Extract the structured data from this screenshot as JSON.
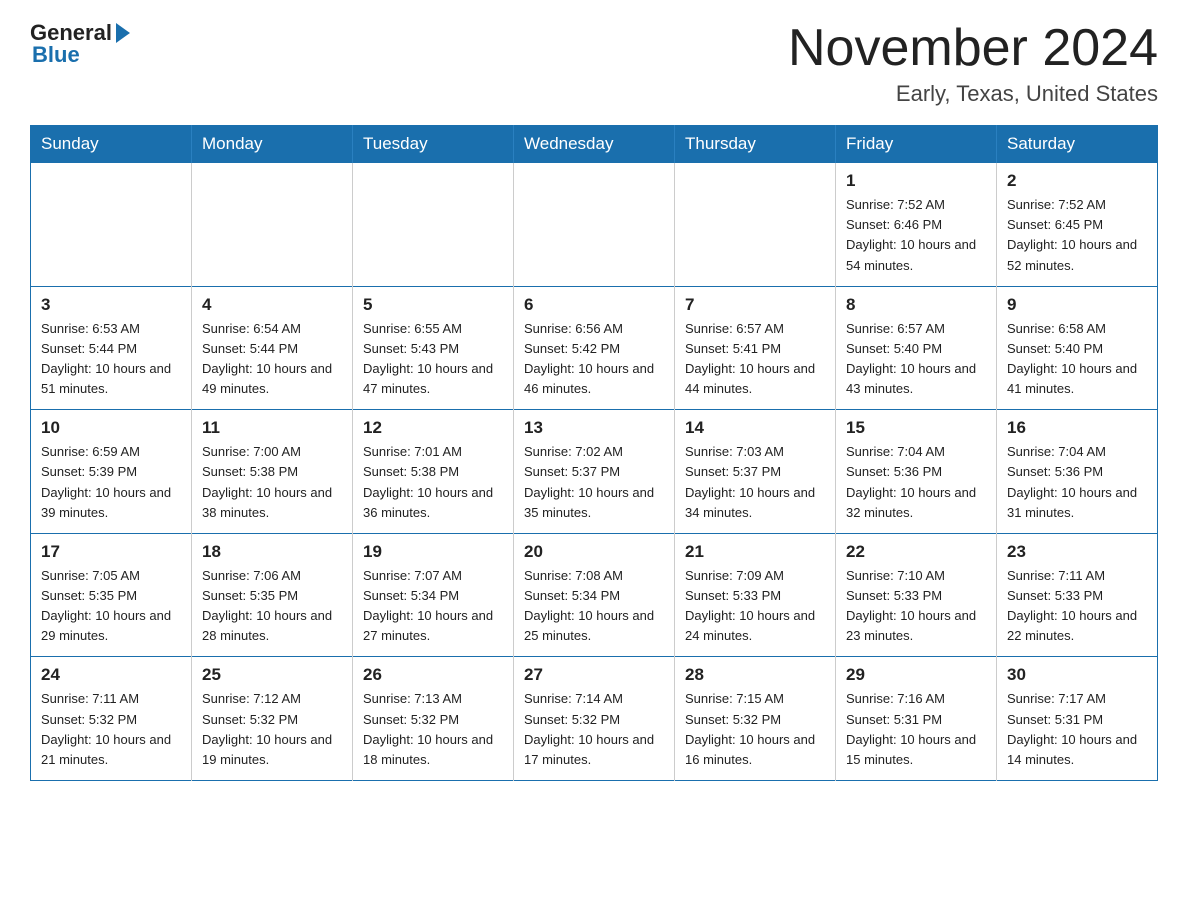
{
  "header": {
    "logo_general": "General",
    "logo_blue": "Blue",
    "month_title": "November 2024",
    "location": "Early, Texas, United States"
  },
  "weekdays": [
    "Sunday",
    "Monday",
    "Tuesday",
    "Wednesday",
    "Thursday",
    "Friday",
    "Saturday"
  ],
  "weeks": [
    [
      {
        "day": "",
        "sunrise": "",
        "sunset": "",
        "daylight": ""
      },
      {
        "day": "",
        "sunrise": "",
        "sunset": "",
        "daylight": ""
      },
      {
        "day": "",
        "sunrise": "",
        "sunset": "",
        "daylight": ""
      },
      {
        "day": "",
        "sunrise": "",
        "sunset": "",
        "daylight": ""
      },
      {
        "day": "",
        "sunrise": "",
        "sunset": "",
        "daylight": ""
      },
      {
        "day": "1",
        "sunrise": "Sunrise: 7:52 AM",
        "sunset": "Sunset: 6:46 PM",
        "daylight": "Daylight: 10 hours and 54 minutes."
      },
      {
        "day": "2",
        "sunrise": "Sunrise: 7:52 AM",
        "sunset": "Sunset: 6:45 PM",
        "daylight": "Daylight: 10 hours and 52 minutes."
      }
    ],
    [
      {
        "day": "3",
        "sunrise": "Sunrise: 6:53 AM",
        "sunset": "Sunset: 5:44 PM",
        "daylight": "Daylight: 10 hours and 51 minutes."
      },
      {
        "day": "4",
        "sunrise": "Sunrise: 6:54 AM",
        "sunset": "Sunset: 5:44 PM",
        "daylight": "Daylight: 10 hours and 49 minutes."
      },
      {
        "day": "5",
        "sunrise": "Sunrise: 6:55 AM",
        "sunset": "Sunset: 5:43 PM",
        "daylight": "Daylight: 10 hours and 47 minutes."
      },
      {
        "day": "6",
        "sunrise": "Sunrise: 6:56 AM",
        "sunset": "Sunset: 5:42 PM",
        "daylight": "Daylight: 10 hours and 46 minutes."
      },
      {
        "day": "7",
        "sunrise": "Sunrise: 6:57 AM",
        "sunset": "Sunset: 5:41 PM",
        "daylight": "Daylight: 10 hours and 44 minutes."
      },
      {
        "day": "8",
        "sunrise": "Sunrise: 6:57 AM",
        "sunset": "Sunset: 5:40 PM",
        "daylight": "Daylight: 10 hours and 43 minutes."
      },
      {
        "day": "9",
        "sunrise": "Sunrise: 6:58 AM",
        "sunset": "Sunset: 5:40 PM",
        "daylight": "Daylight: 10 hours and 41 minutes."
      }
    ],
    [
      {
        "day": "10",
        "sunrise": "Sunrise: 6:59 AM",
        "sunset": "Sunset: 5:39 PM",
        "daylight": "Daylight: 10 hours and 39 minutes."
      },
      {
        "day": "11",
        "sunrise": "Sunrise: 7:00 AM",
        "sunset": "Sunset: 5:38 PM",
        "daylight": "Daylight: 10 hours and 38 minutes."
      },
      {
        "day": "12",
        "sunrise": "Sunrise: 7:01 AM",
        "sunset": "Sunset: 5:38 PM",
        "daylight": "Daylight: 10 hours and 36 minutes."
      },
      {
        "day": "13",
        "sunrise": "Sunrise: 7:02 AM",
        "sunset": "Sunset: 5:37 PM",
        "daylight": "Daylight: 10 hours and 35 minutes."
      },
      {
        "day": "14",
        "sunrise": "Sunrise: 7:03 AM",
        "sunset": "Sunset: 5:37 PM",
        "daylight": "Daylight: 10 hours and 34 minutes."
      },
      {
        "day": "15",
        "sunrise": "Sunrise: 7:04 AM",
        "sunset": "Sunset: 5:36 PM",
        "daylight": "Daylight: 10 hours and 32 minutes."
      },
      {
        "day": "16",
        "sunrise": "Sunrise: 7:04 AM",
        "sunset": "Sunset: 5:36 PM",
        "daylight": "Daylight: 10 hours and 31 minutes."
      }
    ],
    [
      {
        "day": "17",
        "sunrise": "Sunrise: 7:05 AM",
        "sunset": "Sunset: 5:35 PM",
        "daylight": "Daylight: 10 hours and 29 minutes."
      },
      {
        "day": "18",
        "sunrise": "Sunrise: 7:06 AM",
        "sunset": "Sunset: 5:35 PM",
        "daylight": "Daylight: 10 hours and 28 minutes."
      },
      {
        "day": "19",
        "sunrise": "Sunrise: 7:07 AM",
        "sunset": "Sunset: 5:34 PM",
        "daylight": "Daylight: 10 hours and 27 minutes."
      },
      {
        "day": "20",
        "sunrise": "Sunrise: 7:08 AM",
        "sunset": "Sunset: 5:34 PM",
        "daylight": "Daylight: 10 hours and 25 minutes."
      },
      {
        "day": "21",
        "sunrise": "Sunrise: 7:09 AM",
        "sunset": "Sunset: 5:33 PM",
        "daylight": "Daylight: 10 hours and 24 minutes."
      },
      {
        "day": "22",
        "sunrise": "Sunrise: 7:10 AM",
        "sunset": "Sunset: 5:33 PM",
        "daylight": "Daylight: 10 hours and 23 minutes."
      },
      {
        "day": "23",
        "sunrise": "Sunrise: 7:11 AM",
        "sunset": "Sunset: 5:33 PM",
        "daylight": "Daylight: 10 hours and 22 minutes."
      }
    ],
    [
      {
        "day": "24",
        "sunrise": "Sunrise: 7:11 AM",
        "sunset": "Sunset: 5:32 PM",
        "daylight": "Daylight: 10 hours and 21 minutes."
      },
      {
        "day": "25",
        "sunrise": "Sunrise: 7:12 AM",
        "sunset": "Sunset: 5:32 PM",
        "daylight": "Daylight: 10 hours and 19 minutes."
      },
      {
        "day": "26",
        "sunrise": "Sunrise: 7:13 AM",
        "sunset": "Sunset: 5:32 PM",
        "daylight": "Daylight: 10 hours and 18 minutes."
      },
      {
        "day": "27",
        "sunrise": "Sunrise: 7:14 AM",
        "sunset": "Sunset: 5:32 PM",
        "daylight": "Daylight: 10 hours and 17 minutes."
      },
      {
        "day": "28",
        "sunrise": "Sunrise: 7:15 AM",
        "sunset": "Sunset: 5:32 PM",
        "daylight": "Daylight: 10 hours and 16 minutes."
      },
      {
        "day": "29",
        "sunrise": "Sunrise: 7:16 AM",
        "sunset": "Sunset: 5:31 PM",
        "daylight": "Daylight: 10 hours and 15 minutes."
      },
      {
        "day": "30",
        "sunrise": "Sunrise: 7:17 AM",
        "sunset": "Sunset: 5:31 PM",
        "daylight": "Daylight: 10 hours and 14 minutes."
      }
    ]
  ]
}
